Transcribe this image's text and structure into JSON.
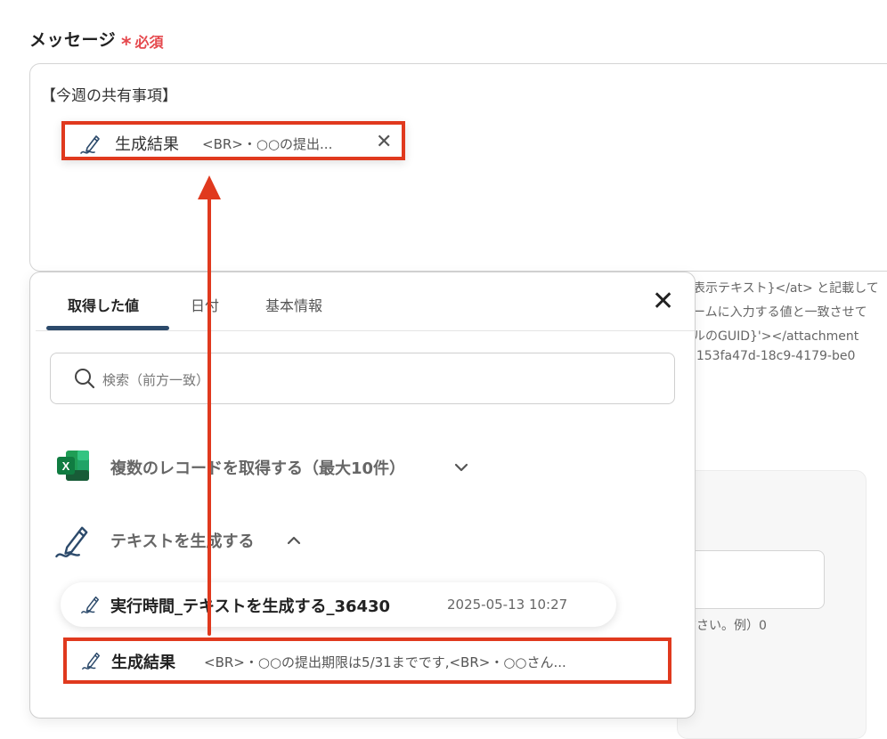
{
  "field": {
    "label": "メッセージ",
    "required_star": "*",
    "required_text": "必須",
    "value_text": "【今週の共有事項】",
    "chip": {
      "title": "生成結果",
      "preview": "<BR>・○○の提出...",
      "remove_icon": "close-icon"
    }
  },
  "help_text": [
    "表示テキスト}</at> と記載して",
    "ームに入力する値と一致させて",
    "ルのGUID}'></attachment",
    "'153fa47d-18c9-4179-be0",
    "ださい。例）0"
  ],
  "picker": {
    "tabs": [
      {
        "label": "取得した値",
        "active": true
      },
      {
        "label": "日付",
        "active": false
      },
      {
        "label": "基本情報",
        "active": false
      }
    ],
    "close_icon": "close-icon",
    "search_placeholder": "検索（前方一致）",
    "groups": [
      {
        "title": "複数のレコードを取得する（最大10件）",
        "icon": "excel-icon",
        "expanded": false
      },
      {
        "title": "テキストを生成する",
        "icon": "pen-icon",
        "expanded": true
      }
    ],
    "items": [
      {
        "name": "実行時間_テキストを生成する_36430",
        "value": "2025-05-13 10:27"
      },
      {
        "name": "生成結果",
        "value": "<BR>・○○の提出期限は5/31までです,<BR>・○○さん..."
      }
    ]
  },
  "colors": {
    "highlight": "#e0391e",
    "tab_active": "#2c4a6b",
    "required": "#e5484d",
    "excel_green": "#107c41"
  }
}
